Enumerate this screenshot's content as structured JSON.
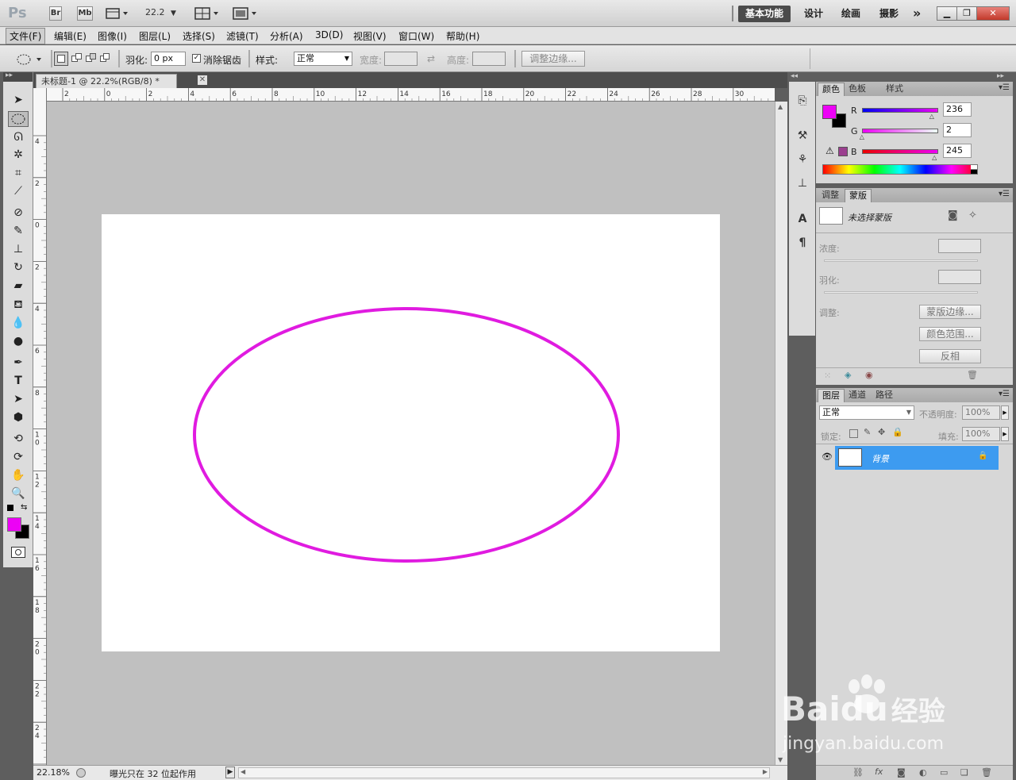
{
  "app": {
    "logo": "Ps",
    "bridge_button": "Br",
    "minibridge_button": "Mb",
    "zoom_value": "22.2",
    "workspaces": [
      "基本功能",
      "设计",
      "绘画",
      "摄影"
    ],
    "more_workspaces": "»"
  },
  "menu": [
    "文件(F)",
    "编辑(E)",
    "图像(I)",
    "图层(L)",
    "选择(S)",
    "滤镜(T)",
    "分析(A)",
    "3D(D)",
    "视图(V)",
    "窗口(W)",
    "帮助(H)"
  ],
  "options": {
    "feather_label": "羽化:",
    "feather_value": "0 px",
    "antialias_checked": true,
    "antialias_label": "消除锯齿",
    "style_label": "样式:",
    "style_value": "正常",
    "width_label": "宽度:",
    "height_label": "高度:",
    "refine_edge": "调整边缘..."
  },
  "document": {
    "tab_title": "未标题-1 @ 22.2%(RGB/8) *",
    "ruler_h": [
      "2",
      "0",
      "2",
      "4",
      "6",
      "8",
      "10",
      "12",
      "14",
      "16",
      "18",
      "20",
      "22",
      "24",
      "26",
      "28",
      "30",
      "32"
    ],
    "ruler_v": [
      "4",
      "2",
      "0",
      "2",
      "4",
      "6",
      "8",
      "1 0",
      "1 2",
      "1 4",
      "1 6",
      "1 8",
      "2 0",
      "2 2",
      "2 4",
      "2"
    ],
    "zoom_status": "22.18%",
    "status_text": "曝光只在 32 位起作用",
    "ellipse_stroke": "#e01be0"
  },
  "colors": {
    "foreground": "#ec02f5",
    "background": "#000000"
  },
  "color_panel": {
    "tabs": [
      "颜色",
      "色板",
      "样式"
    ],
    "r_label": "R",
    "r_value": "236",
    "g_label": "G",
    "g_value": "2",
    "b_label": "B",
    "b_value": "245",
    "r_level": 0.925,
    "g_level": 0.008,
    "b_level": 0.96
  },
  "masks_panel": {
    "tabs": [
      "调整",
      "蒙版"
    ],
    "mask_label": "未选择蒙版",
    "density_label": "浓度:",
    "feather_label": "羽化:",
    "refine_label": "调整:",
    "mask_edge": "蒙版边缘...",
    "color_range": "颜色范围...",
    "invert": "反相"
  },
  "layers_panel": {
    "tabs": [
      "图层",
      "通道",
      "路径"
    ],
    "blend_mode": "正常",
    "opacity_label": "不透明度:",
    "opacity_value": "100%",
    "lock_label": "锁定:",
    "fill_label": "填充:",
    "fill_value": "100%",
    "layers": [
      {
        "name": "背景",
        "selected": true,
        "locked": true
      }
    ]
  },
  "watermark": {
    "brand_text": "Bai",
    "brand_suffix": "du",
    "brand_cn": "经验",
    "url": "jingyan.baidu.com"
  }
}
